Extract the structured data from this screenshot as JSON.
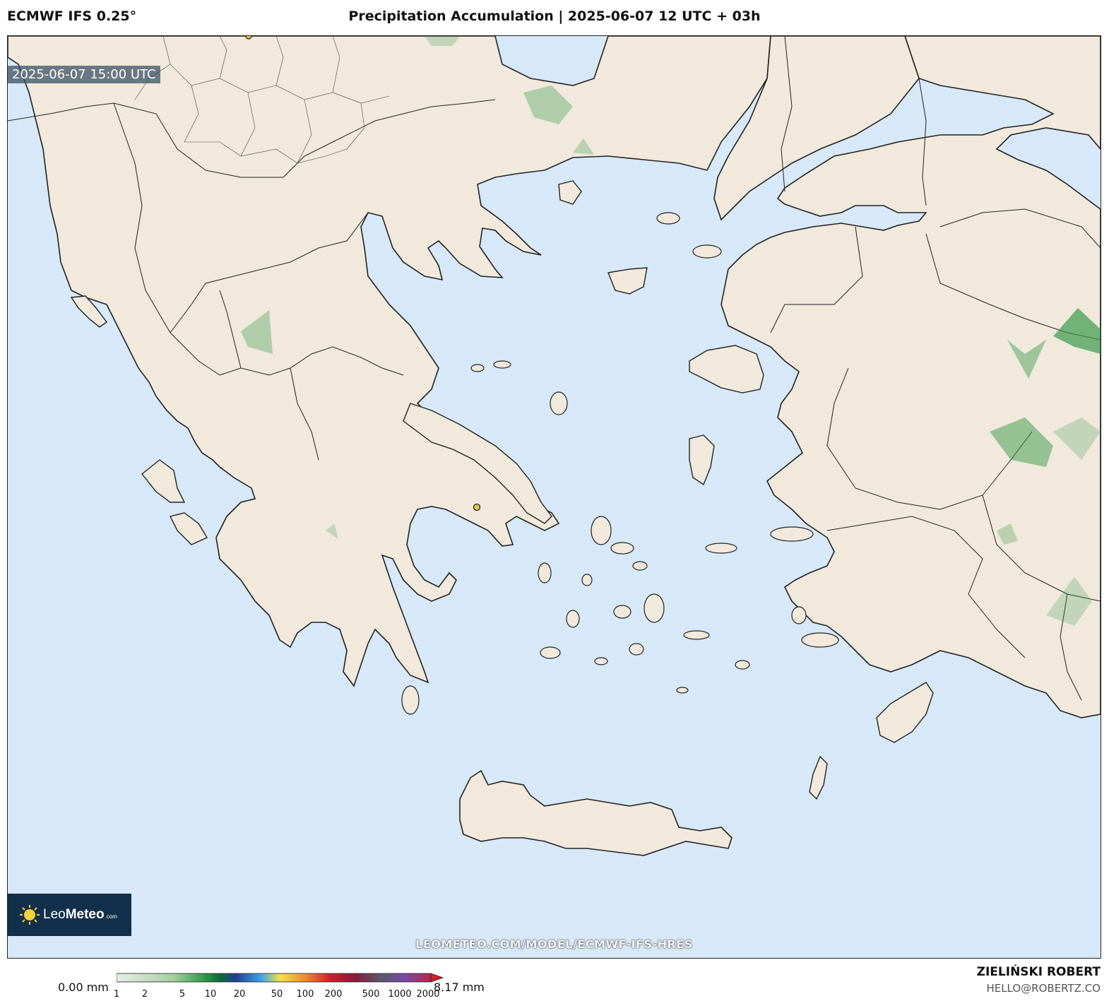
{
  "header": {
    "model": "ECMWF IFS 0.25°",
    "title": "Precipitation Accumulation | 2025-06-07 12 UTC + 03h"
  },
  "map": {
    "valid_time": "2025-06-07 15:00 UTC",
    "logo_brand_light": "Leo",
    "logo_brand_bold": "Meteo",
    "logo_suffix": ".com",
    "watermark": "LEOMETEO.COM/MODEL/ECMWF-IFS-HRES",
    "colors": {
      "sea": "#d7e8f8",
      "land": "#f0e9dc",
      "border": "#222222",
      "precip": "#3a9a4a",
      "city_marker": "#e3c84a"
    }
  },
  "legend": {
    "min_label": "0.00 mm",
    "max_label": "8.17 mm",
    "ticks": [
      "1",
      "2",
      "5",
      "10",
      "20",
      "50",
      "100",
      "200",
      "500",
      "1000",
      "2000"
    ]
  },
  "footer": {
    "author": "ZIELIŃSKI ROBERT",
    "email": "HELLO@ROBERTZ.CO"
  }
}
